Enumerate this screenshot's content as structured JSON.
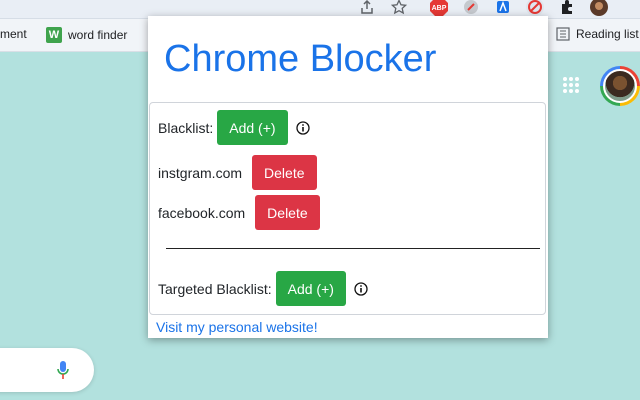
{
  "browser": {
    "bookmarks": [
      {
        "label": "ment"
      },
      {
        "label": "word finder",
        "badge": "W"
      }
    ],
    "reading_list_label": "Reading list",
    "abp_badge": "ABP"
  },
  "popup": {
    "title": "Chrome Blocker",
    "blacklist": {
      "label": "Blacklist:",
      "add_label": "Add (+)",
      "items": [
        {
          "domain": "instgram.com",
          "delete_label": "Delete"
        },
        {
          "domain": "facebook.com",
          "delete_label": "Delete"
        }
      ]
    },
    "targeted_blacklist": {
      "label": "Targeted Blacklist:",
      "add_label": "Add (+)"
    },
    "website_link": "Visit my personal website!"
  },
  "colors": {
    "title_blue": "#1a73e8",
    "add_green": "#28a745",
    "delete_red": "#dc3545",
    "page_background": "#b2e1de"
  }
}
